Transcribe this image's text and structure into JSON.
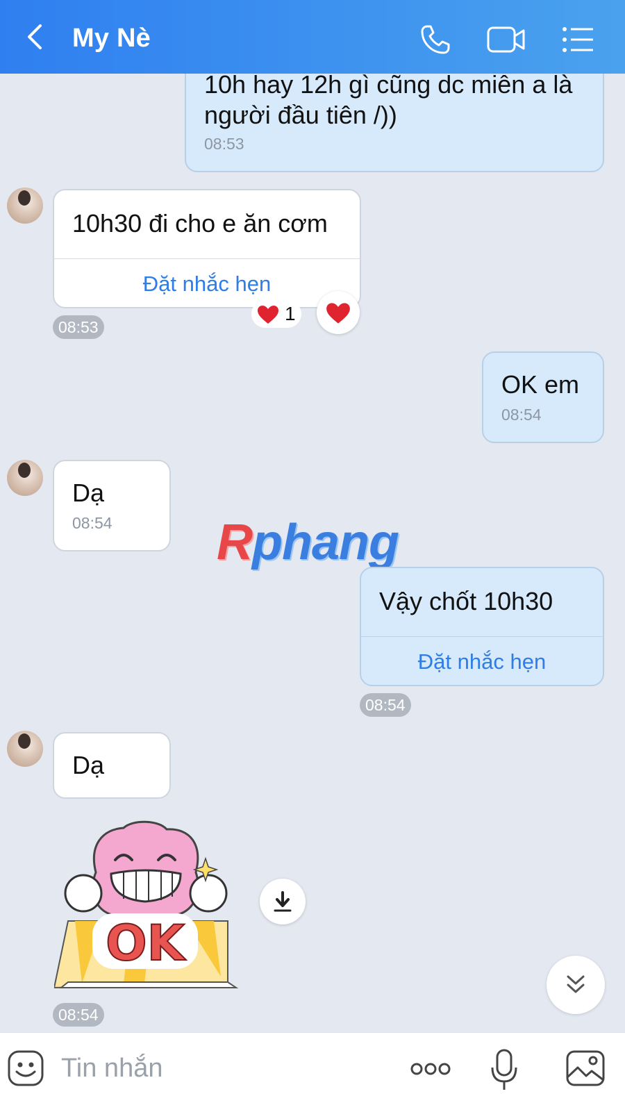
{
  "header": {
    "title": "My Nè"
  },
  "messages": {
    "m1": {
      "text": "10h hay 12h gì cũng dc miễn a là\nngười đầu tiên /))",
      "time": "08:53"
    },
    "m2": {
      "text": "10h30 đi cho e ăn cơm",
      "reminder": "Đặt nhắc hẹn",
      "time": "08:53",
      "reaction_count": "1"
    },
    "m3": {
      "text": "OK em",
      "time": "08:54"
    },
    "m4": {
      "text": "Dạ",
      "time": "08:54"
    },
    "m5": {
      "text": "Vậy chốt 10h30",
      "reminder": "Đặt nhắc hẹn",
      "time": "08:54"
    },
    "m6": {
      "text": "Dạ"
    },
    "m7": {
      "sticker_label": "OK",
      "time": "08:54"
    }
  },
  "watermark": {
    "first": "R",
    "rest": "phang"
  },
  "composer": {
    "placeholder": "Tin nhắn"
  },
  "colors": {
    "header_start": "#2f7ff0",
    "header_end": "#4aa2ee",
    "link": "#2f7de6",
    "outgoing_bubble": "#d7eafb"
  },
  "icons": [
    "back-icon",
    "phone-icon",
    "video-icon",
    "menu-icon",
    "heart-icon",
    "download-icon",
    "chevron-double-down-icon",
    "emoji-icon",
    "more-icon",
    "microphone-icon",
    "image-icon"
  ]
}
